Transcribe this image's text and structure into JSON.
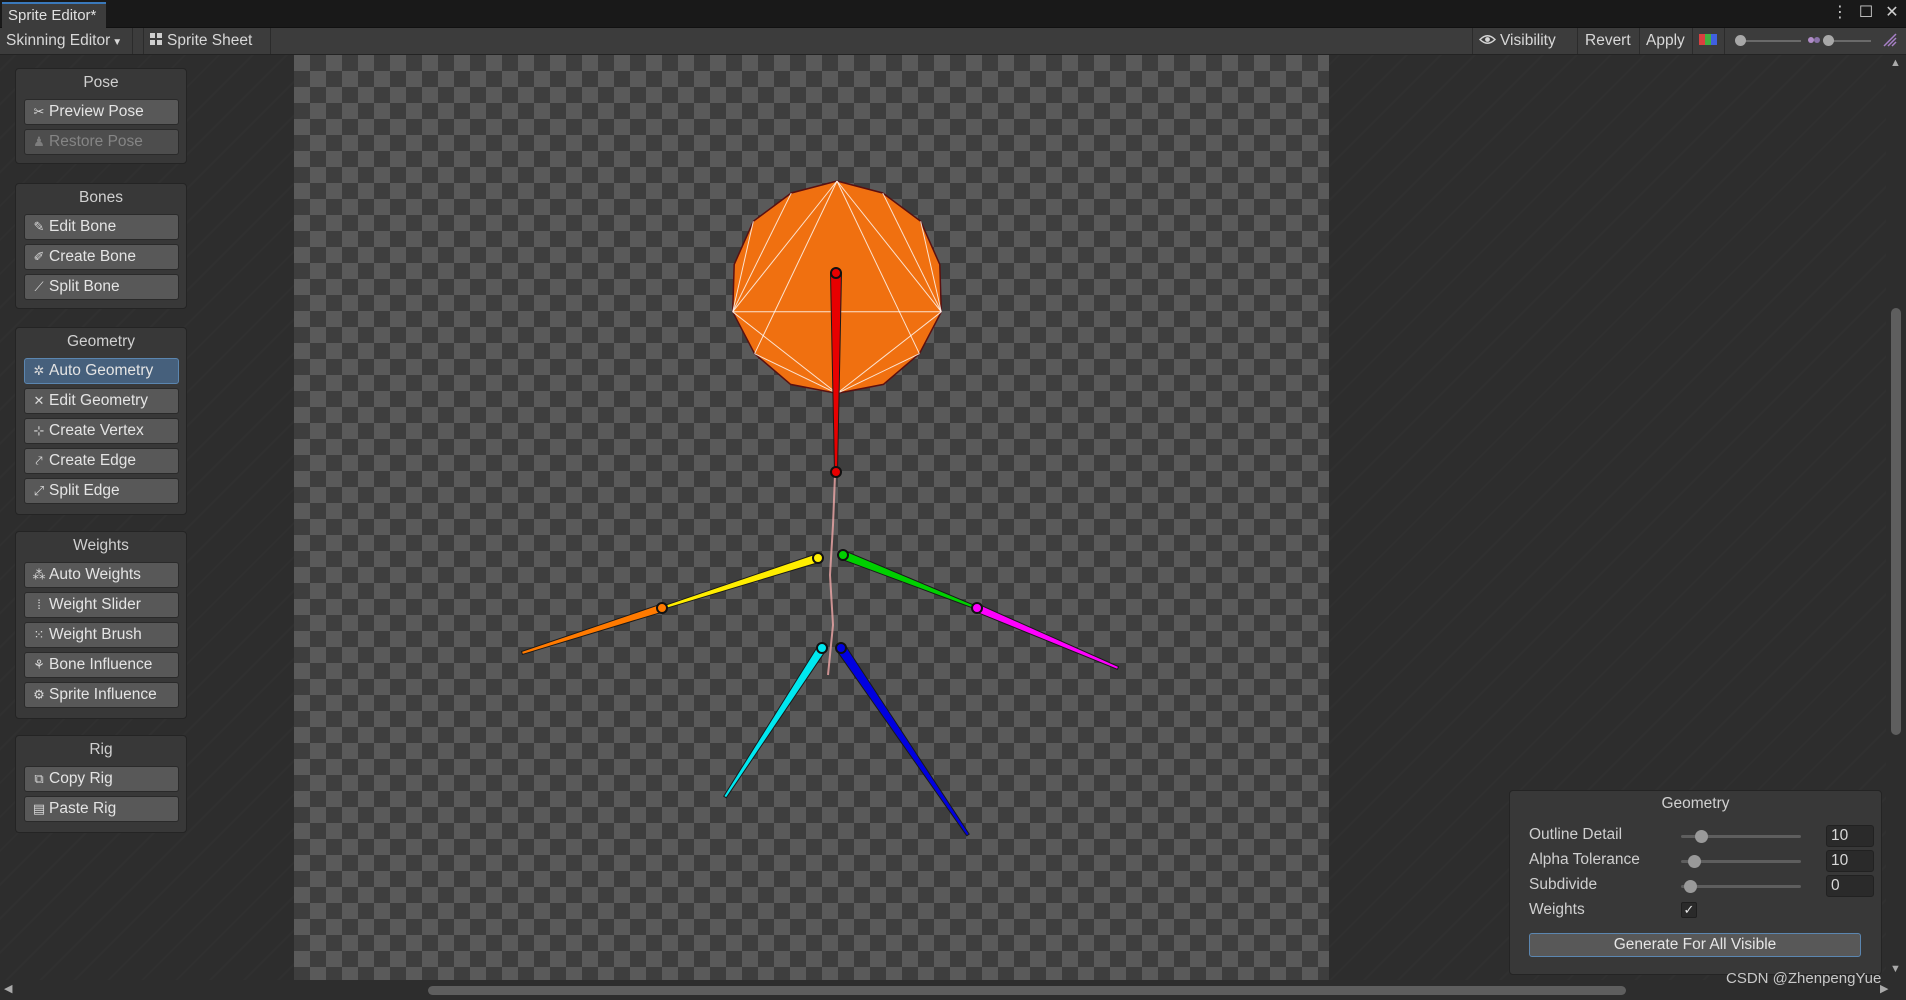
{
  "window": {
    "tab_title": "Sprite Editor*",
    "controls": [
      "⋮",
      "☐",
      "✕"
    ]
  },
  "toolbar": {
    "mode_dropdown": "Skinning Editor",
    "mode_arrow": "▼",
    "sprite_sheet": "Sprite Sheet",
    "sprite_sheet_icon": "grid-icon",
    "visibility": "Visibility",
    "visibility_icon": "eye-icon",
    "revert": "Revert",
    "apply": "Apply",
    "color_toggle_icon": "rgb-channels-icon",
    "zoom_slider_level": 0.0,
    "mip_slider_level": 0.0
  },
  "pose": {
    "title": "Pose",
    "buttons": [
      {
        "label": "Preview Pose",
        "icon": "pose-icon",
        "state": "normal"
      },
      {
        "label": "Restore Pose",
        "icon": "restore-pose-icon",
        "state": "disabled"
      }
    ]
  },
  "bones": {
    "title": "Bones",
    "buttons": [
      {
        "label": "Edit Bone",
        "icon": "edit-bone-icon"
      },
      {
        "label": "Create Bone",
        "icon": "create-bone-icon"
      },
      {
        "label": "Split Bone",
        "icon": "split-bone-icon"
      }
    ]
  },
  "geometry_tools": {
    "title": "Geometry",
    "buttons": [
      {
        "label": "Auto Geometry",
        "icon": "auto-geometry-icon",
        "state": "active"
      },
      {
        "label": "Edit Geometry",
        "icon": "edit-geometry-icon"
      },
      {
        "label": "Create Vertex",
        "icon": "create-vertex-icon"
      },
      {
        "label": "Create Edge",
        "icon": "create-edge-icon"
      },
      {
        "label": "Split Edge",
        "icon": "split-edge-icon"
      }
    ]
  },
  "weights": {
    "title": "Weights",
    "buttons": [
      {
        "label": "Auto Weights",
        "icon": "auto-weights-icon"
      },
      {
        "label": "Weight Slider",
        "icon": "weight-slider-icon"
      },
      {
        "label": "Weight Brush",
        "icon": "weight-brush-icon"
      },
      {
        "label": "Bone Influence",
        "icon": "bone-influence-icon"
      },
      {
        "label": "Sprite Influence",
        "icon": "sprite-influence-icon"
      }
    ]
  },
  "rig": {
    "title": "Rig",
    "buttons": [
      {
        "label": "Copy Rig",
        "icon": "copy-rig-icon"
      },
      {
        "label": "Paste Rig",
        "icon": "paste-rig-icon"
      }
    ]
  },
  "geometry_settings": {
    "title": "Geometry",
    "outline_detail": {
      "label": "Outline Detail",
      "value": "10",
      "slider_fraction": 0.1
    },
    "alpha_tolerance": {
      "label": "Alpha Tolerance",
      "value": "10",
      "slider_fraction": 0.04
    },
    "subdivide": {
      "label": "Subdivide",
      "value": "0",
      "slider_fraction": 0.0
    },
    "weights": {
      "label": "Weights",
      "checked": true,
      "check_glyph": "✓"
    },
    "generate_button": "Generate For All Visible"
  },
  "watermark": "CSDN @ZhenpengYue",
  "bone_colors": [
    "#e80000",
    "#ffee00",
    "#ff7a00",
    "#00d000",
    "#ff00ff",
    "#00e8f0",
    "#0000e0"
  ],
  "head_color": "#f07010"
}
